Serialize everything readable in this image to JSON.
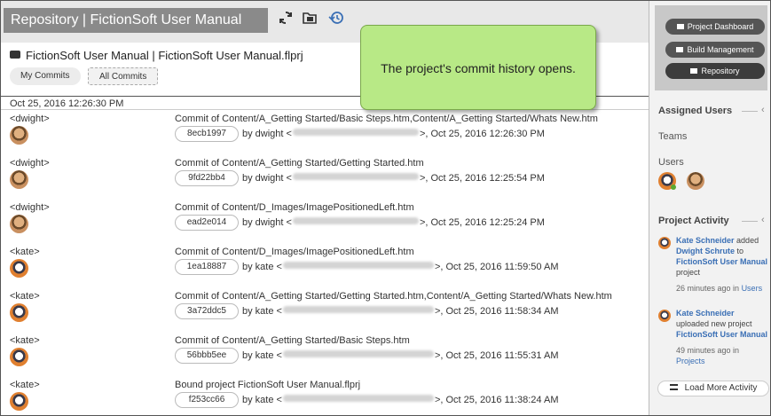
{
  "header": {
    "title": "Repository  |  FictionSoft User Manual",
    "icons": [
      "sync-icon",
      "folder-icon",
      "history-icon"
    ]
  },
  "project_line": "FictionSoft User Manual  |  FictionSoft User Manual.flprj",
  "tabs": [
    {
      "label": "My Commits"
    },
    {
      "label": "All Commits",
      "selected": true
    }
  ],
  "date_header": "Oct 25, 2016 12:26:30 PM",
  "commits": [
    {
      "user": "<dwight>",
      "avatar": "dwight",
      "message": "Commit of Content/A_Getting Started/Basic Steps.htm,Content/A_Getting Started/Whats New.htm",
      "hash": "8ecb1997",
      "by": "by dwight <",
      "date": ">, Oct 25, 2016 12:26:30 PM"
    },
    {
      "user": "<dwight>",
      "avatar": "dwight",
      "message": "Commit of Content/A_Getting Started/Getting Started.htm",
      "hash": "9fd22bb4",
      "by": "by dwight <",
      "date": ">, Oct 25, 2016 12:25:54 PM"
    },
    {
      "user": "<dwight>",
      "avatar": "dwight",
      "message": "Commit of Content/D_Images/ImagePositionedLeft.htm",
      "hash": "ead2e014",
      "by": "by dwight <",
      "date": ">, Oct 25, 2016 12:25:24 PM"
    },
    {
      "user": "<kate>",
      "avatar": "kate",
      "message": "Commit of Content/D_Images/ImagePositionedLeft.htm",
      "hash": "1ea18887",
      "by": "by kate <",
      "date": ">, Oct 25, 2016 11:59:50 AM"
    },
    {
      "user": "<kate>",
      "avatar": "kate",
      "message": "Commit of Content/A_Getting Started/Getting Started.htm,Content/A_Getting Started/Whats New.htm",
      "hash": "3a72ddc5",
      "by": "by kate <",
      "date": ">, Oct 25, 2016 11:58:34 AM"
    },
    {
      "user": "<kate>",
      "avatar": "kate",
      "message": "Commit of Content/A_Getting Started/Basic Steps.htm",
      "hash": "56bbb5ee",
      "by": "by kate <",
      "date": ">, Oct 25, 2016 11:55:31 AM"
    },
    {
      "user": "<kate>",
      "avatar": "kate",
      "message": "Bound project FictionSoft User Manual.flprj",
      "hash": "f253cc66",
      "by": "by kate <",
      "date": ">, Oct 25, 2016 11:38:24 AM"
    }
  ],
  "callout": "The project's commit history opens.",
  "sidebar": {
    "buttons": [
      {
        "label": "Project Dashboard"
      },
      {
        "label": "Build Management"
      },
      {
        "label": "Repository",
        "selected": true
      }
    ],
    "assigned_users_title": "Assigned Users",
    "teams_label": "Teams",
    "users_label": "Users",
    "project_activity_title": "Project Activity",
    "activities": [
      {
        "actor": "Kate Schneider",
        "text1": "added",
        "target": "Dwight Schrute",
        "text2": "to",
        "project": "FictionSoft User Manual",
        "text3": "project",
        "time": "26 minutes ago in",
        "where": "Users"
      },
      {
        "actor": "Kate Schneider",
        "text1": "uploaded new project",
        "project": "FictionSoft User Manual",
        "time": "49 minutes ago in",
        "where": "Projects"
      }
    ],
    "load_more": "Load More Activity"
  }
}
